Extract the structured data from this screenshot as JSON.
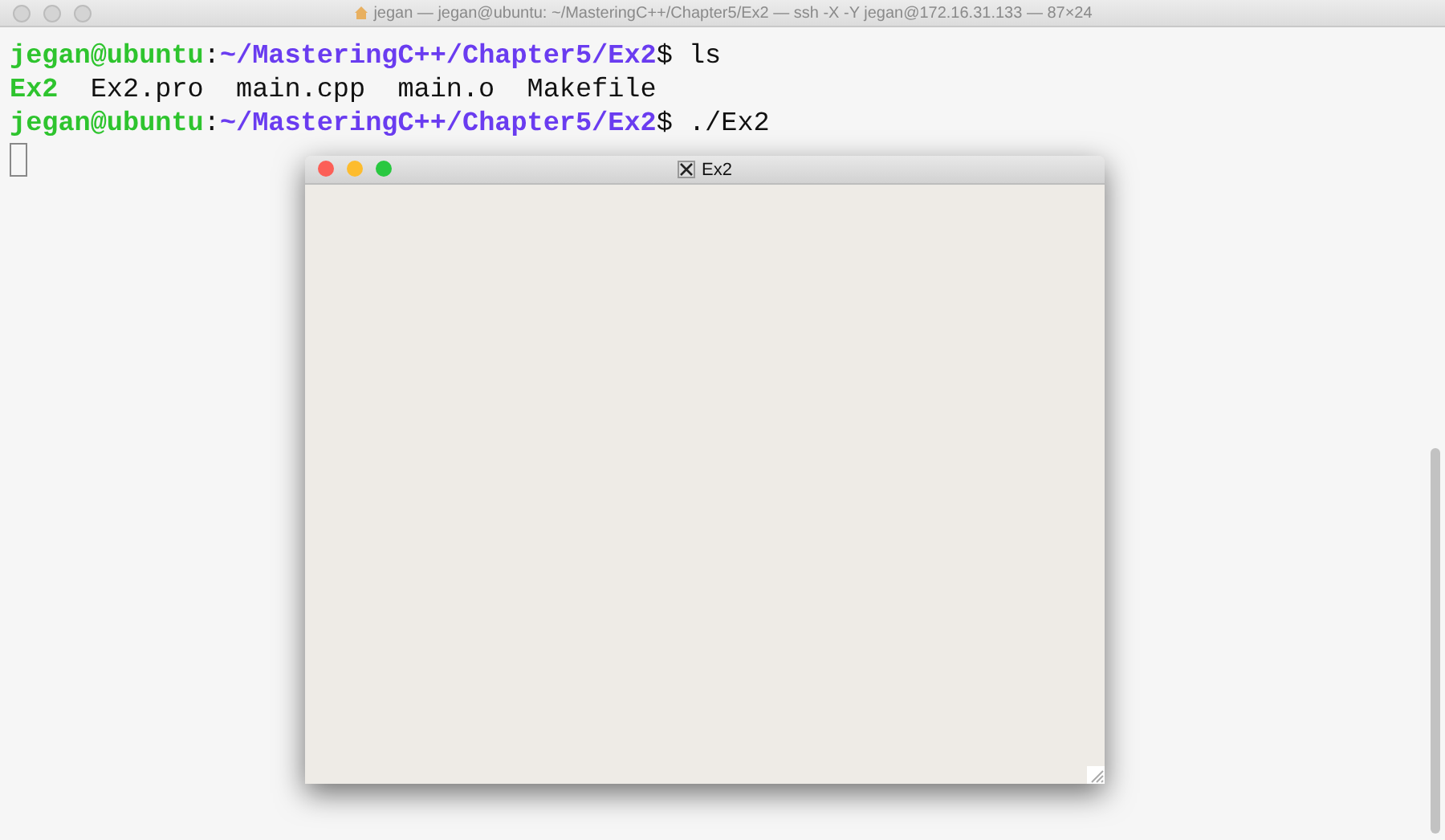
{
  "window": {
    "title": "jegan — jegan@ubuntu: ~/MasteringC++/Chapter5/Ex2 — ssh -X -Y jegan@172.16.31.133 — 87×24"
  },
  "terminal": {
    "lines": [
      {
        "segments": [
          {
            "kind": "user",
            "text": "jegan@ubuntu"
          },
          {
            "kind": "plain",
            "text": ":"
          },
          {
            "kind": "path",
            "text": "~/MasteringC++/Chapter5/Ex2"
          },
          {
            "kind": "plain",
            "text": "$ ls"
          }
        ]
      },
      {
        "segments": [
          {
            "kind": "exec",
            "text": "Ex2"
          },
          {
            "kind": "plain",
            "text": "  Ex2.pro  main.cpp  main.o  Makefile"
          }
        ]
      },
      {
        "segments": [
          {
            "kind": "user",
            "text": "jegan@ubuntu"
          },
          {
            "kind": "plain",
            "text": ":"
          },
          {
            "kind": "path",
            "text": "~/MasteringC++/Chapter5/Ex2"
          },
          {
            "kind": "plain",
            "text": "$ ./Ex2"
          }
        ]
      }
    ]
  },
  "x_window": {
    "title": "Ex2"
  }
}
